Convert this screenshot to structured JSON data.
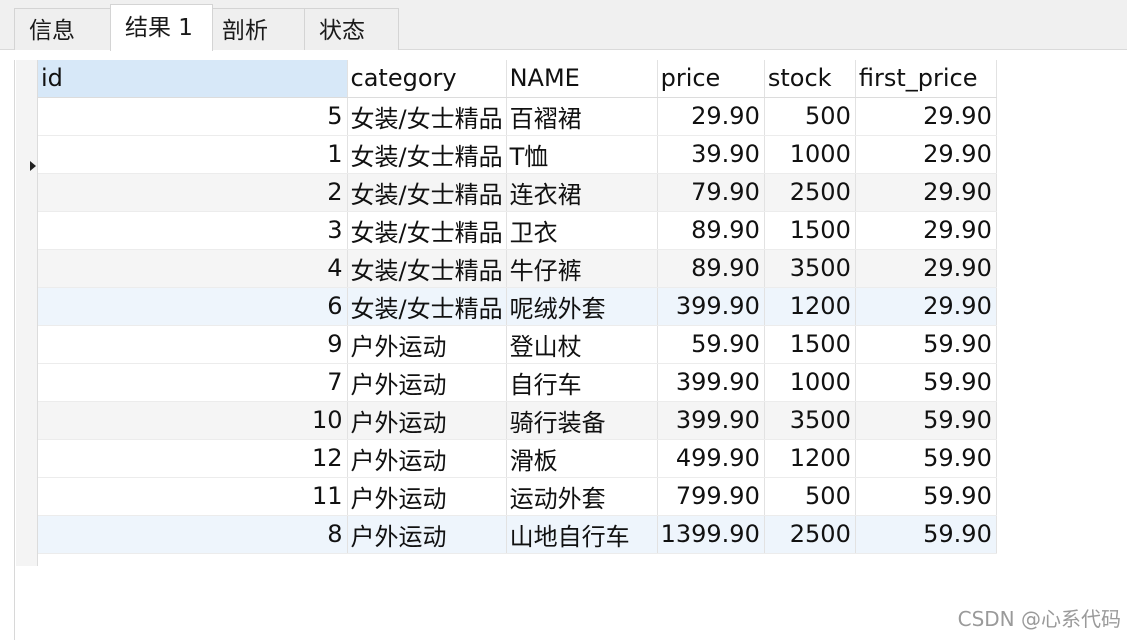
{
  "tabs": [
    {
      "label": "信息"
    },
    {
      "label": "结果 1"
    },
    {
      "label": "剖析"
    },
    {
      "label": "状态"
    }
  ],
  "table": {
    "columns": [
      "id",
      "category",
      "NAME",
      "price",
      "stock",
      "first_price"
    ],
    "rows": [
      {
        "id": "5",
        "category": "女装/女士精品",
        "name": "百褶裙",
        "price": "29.90",
        "stock": "500",
        "first_price": "29.90"
      },
      {
        "id": "1",
        "category": "女装/女士精品",
        "name": "T恤",
        "price": "39.90",
        "stock": "1000",
        "first_price": "29.90"
      },
      {
        "id": "2",
        "category": "女装/女士精品",
        "name": "连衣裙",
        "price": "79.90",
        "stock": "2500",
        "first_price": "29.90"
      },
      {
        "id": "3",
        "category": "女装/女士精品",
        "name": "卫衣",
        "price": "89.90",
        "stock": "1500",
        "first_price": "29.90"
      },
      {
        "id": "4",
        "category": "女装/女士精品",
        "name": "牛仔裤",
        "price": "89.90",
        "stock": "3500",
        "first_price": "29.90"
      },
      {
        "id": "6",
        "category": "女装/女士精品",
        "name": "呢绒外套",
        "price": "399.90",
        "stock": "1200",
        "first_price": "29.90"
      },
      {
        "id": "9",
        "category": "户外运动",
        "name": "登山杖",
        "price": "59.90",
        "stock": "1500",
        "first_price": "59.90"
      },
      {
        "id": "7",
        "category": "户外运动",
        "name": "自行车",
        "price": "399.90",
        "stock": "1000",
        "first_price": "59.90"
      },
      {
        "id": "10",
        "category": "户外运动",
        "name": "骑行装备",
        "price": "399.90",
        "stock": "3500",
        "first_price": "59.90"
      },
      {
        "id": "12",
        "category": "户外运动",
        "name": "滑板",
        "price": "499.90",
        "stock": "1200",
        "first_price": "59.90"
      },
      {
        "id": "11",
        "category": "户外运动",
        "name": "运动外套",
        "price": "799.90",
        "stock": "500",
        "first_price": "59.90"
      },
      {
        "id": "8",
        "category": "户外运动",
        "name": "山地自行车",
        "price": "1399.90",
        "stock": "2500",
        "first_price": "59.90"
      }
    ]
  },
  "watermark": "CSDN @心系代码",
  "colors": {
    "tab_bar_bg": "#f0f0f0",
    "active_header_bg": "#d7e8f8",
    "alt_row_bg": "#f5f5f5",
    "highlight_row_bg": "#eef5fc"
  },
  "icons": {
    "current_row_indicator": "caret-right-icon"
  }
}
